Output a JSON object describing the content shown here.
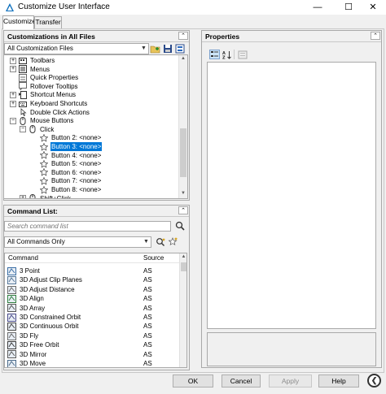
{
  "window": {
    "title": "Customize User Interface",
    "minimize_glyph": "—",
    "maximize_glyph": "☐",
    "close_glyph": "✕"
  },
  "tabs": [
    {
      "label": "Customize",
      "active": true
    },
    {
      "label": "Transfer",
      "active": false
    }
  ],
  "customizations": {
    "header": "Customizations in All Files",
    "collapse_glyph": "⌃",
    "dropdown_value": "All Customization Files",
    "tree": [
      {
        "label": "Toolbars",
        "level": 1,
        "expander": "+",
        "icon": "toolbars-icon"
      },
      {
        "label": "Menus",
        "level": 1,
        "expander": "+",
        "icon": "menus-icon"
      },
      {
        "label": "Quick Properties",
        "level": 1,
        "expander": "",
        "icon": "quick-properties-icon"
      },
      {
        "label": "Rollover Tooltips",
        "level": 1,
        "expander": "",
        "icon": "rollover-tooltips-icon"
      },
      {
        "label": "Shortcut Menus",
        "level": 1,
        "expander": "+",
        "icon": "shortcut-menus-icon"
      },
      {
        "label": "Keyboard Shortcuts",
        "level": 1,
        "expander": "+",
        "icon": "keyboard-shortcuts-icon"
      },
      {
        "label": "Double Click Actions",
        "level": 1,
        "expander": "",
        "icon": "double-click-icon"
      },
      {
        "label": "Mouse Buttons",
        "level": 1,
        "expander": "−",
        "icon": "mouse-icon"
      },
      {
        "label": "Click",
        "level": 2,
        "expander": "−",
        "icon": "mouse-icon"
      },
      {
        "label": "Button 2: <none>",
        "level": 3,
        "expander": "",
        "icon": "star-icon"
      },
      {
        "label": "Button 3: <none>",
        "level": 3,
        "expander": "",
        "icon": "star-icon",
        "selected": true
      },
      {
        "label": "Button 4: <none>",
        "level": 3,
        "expander": "",
        "icon": "star-icon"
      },
      {
        "label": "Button 5: <none>",
        "level": 3,
        "expander": "",
        "icon": "star-icon"
      },
      {
        "label": "Button 6: <none>",
        "level": 3,
        "expander": "",
        "icon": "star-icon"
      },
      {
        "label": "Button 7: <none>",
        "level": 3,
        "expander": "",
        "icon": "star-icon"
      },
      {
        "label": "Button 8: <none>",
        "level": 3,
        "expander": "",
        "icon": "star-icon"
      },
      {
        "label": "Shift+Click",
        "level": 2,
        "expander": "+",
        "icon": "mouse-icon"
      }
    ]
  },
  "command_list": {
    "header": "Command List:",
    "search_placeholder": "Search command list",
    "filter_value": "All Commands Only",
    "columns": {
      "command": "Command",
      "source": "Source"
    },
    "rows": [
      {
        "command": "3 Point",
        "source": "AS"
      },
      {
        "command": "3D Adjust Clip Planes",
        "source": "AS"
      },
      {
        "command": "3D Adjust Distance",
        "source": "AS"
      },
      {
        "command": "3D Align",
        "source": "AS"
      },
      {
        "command": "3D Array",
        "source": "AS"
      },
      {
        "command": "3D Constrained Orbit",
        "source": "AS"
      },
      {
        "command": "3D Continuous Orbit",
        "source": "AS"
      },
      {
        "command": "3D Fly",
        "source": "AS"
      },
      {
        "command": "3D Free Orbit",
        "source": "AS"
      },
      {
        "command": "3D Mirror",
        "source": "AS"
      },
      {
        "command": "3D Move",
        "source": "AS"
      }
    ]
  },
  "properties": {
    "header": "Properties"
  },
  "buttons": {
    "ok": "OK",
    "cancel": "Cancel",
    "apply": "Apply",
    "help": "Help",
    "back_glyph": "❮"
  },
  "colors": {
    "selection": "#0078d7",
    "autocad_brand": "#0a6ebd"
  }
}
